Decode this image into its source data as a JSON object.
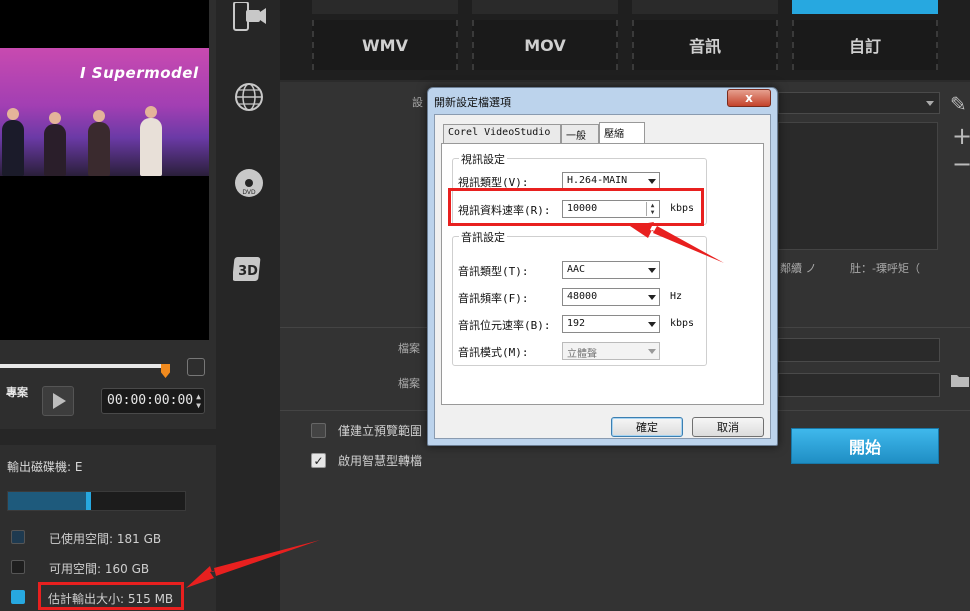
{
  "format_tabs": [
    {
      "label": "WMV",
      "active": false
    },
    {
      "label": "MOV",
      "active": false
    },
    {
      "label": "音訊",
      "active": false
    },
    {
      "label": "自訂",
      "active": true
    }
  ],
  "preview": {
    "banner_text": "I Supermodel",
    "project_label": "專案",
    "timecode": "00:00:00:00",
    "progress": 0.8
  },
  "disk": {
    "output_drive": "輸出磁碟機: E",
    "used_space": "已使用空間: 181 GB",
    "free_space": "可用空間: 160 GB",
    "estimated_output": "估計輸出大小: 515 MB",
    "used_fraction": 0.46
  },
  "main": {
    "settings_label": "設",
    "file_label_1": "檔案",
    "file_label_2": "檔案",
    "right_snippet_1": "鄰續 ノ",
    "right_snippet_2": "肚：-瑮呼矩（",
    "preview_only_label": "僅建立預覽範圍",
    "smart_render_label": "啟用智慧型轉檔",
    "start_button": "開始"
  },
  "dialog": {
    "title": "開新設定檔選項",
    "close_symbol": "x",
    "tabs": [
      "Corel VideoStudio",
      "一般",
      "壓縮"
    ],
    "active_tab": "壓縮",
    "video_group": "視訊設定",
    "video_type_label": "視訊類型(V):",
    "video_type_value": "H.264-MAIN",
    "bitrate_label": "視訊資料速率(R):",
    "bitrate_value": "10000",
    "bitrate_unit": "kbps",
    "audio_group": "音訊設定",
    "audio_type_label": "音訊類型(T):",
    "audio_type_value": "AAC",
    "audio_freq_label": "音訊頻率(F):",
    "audio_freq_value": "48000",
    "audio_freq_unit": "Hz",
    "audio_bitrate_label": "音訊位元速率(B):",
    "audio_bitrate_value": "192",
    "audio_bitrate_unit": "kbps",
    "audio_mode_label": "音訊模式(M):",
    "audio_mode_value": "立體聲",
    "ok_button": "確定",
    "cancel_button": "取消"
  },
  "colors": {
    "accent": "#27a8e0",
    "highlight": "#e8201f"
  }
}
